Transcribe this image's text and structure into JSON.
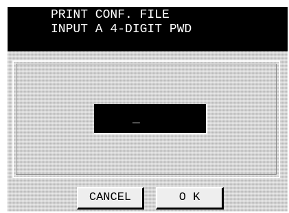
{
  "header": {
    "line1": "PRINT CONF. FILE",
    "line2": "INPUT A 4-DIGIT PWD"
  },
  "password": {
    "value": "_"
  },
  "buttons": {
    "cancel_label": "CANCEL",
    "ok_label": "O K"
  },
  "colors": {
    "title_background": "#000000",
    "title_text": "#ffffff",
    "screen_background": "#cfcfcf",
    "button_face": "#eeeeee"
  }
}
